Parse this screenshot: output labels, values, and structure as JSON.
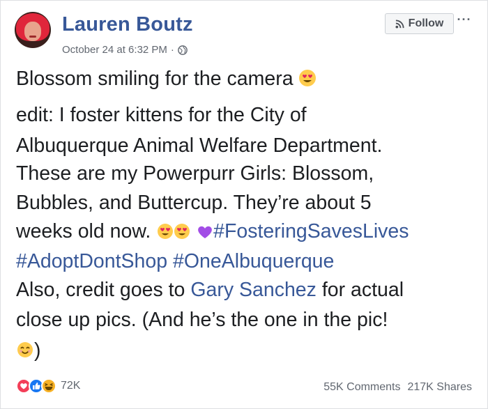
{
  "post": {
    "author": "Lauren Boutz",
    "date": "October 24 at 6:32 PM",
    "separator": "·",
    "privacy_icon": "globe-icon",
    "follow_label": "Follow",
    "more_label": "···",
    "body": {
      "line1": "Blossom smiling for the camera",
      "line2": "edit: I foster kittens for the City of",
      "line3": "Albuquerque Animal Welfare Department.",
      "line4": "These are my Powerpurr Girls: Blossom,",
      "line5": "Bubbles, and Buttercup. They’re about 5",
      "line6_text": "weeks old now.",
      "hashtag1": "#FosteringSavesLives",
      "hashtag2": "#AdoptDontShop",
      "hashtag3": "#OneAlbuquerque",
      "line8_pre": "Also, credit goes to",
      "mention": "Gary Sanchez",
      "line8_post": "for actual",
      "line9": "close up pics. (And he’s the one in the pic!",
      "line10_close": ")"
    },
    "emojis": [
      "heart-eyes-emoji",
      "heart-eyes-emoji",
      "heart-eyes-emoji",
      "purple-heart-emoji",
      "smiling-emoji"
    ],
    "reactions": {
      "icons": [
        "love-reaction-icon",
        "like-reaction-icon",
        "haha-reaction-icon"
      ],
      "count": "72K"
    },
    "comments": "55K Comments",
    "shares": "217K Shares"
  },
  "colors": {
    "link": "#385898",
    "text": "#1c1e21",
    "meta": "#616770",
    "love": "#f33e58",
    "like": "#1877f2",
    "haha": "#f7b125",
    "purple_heart": "#a24de6"
  }
}
